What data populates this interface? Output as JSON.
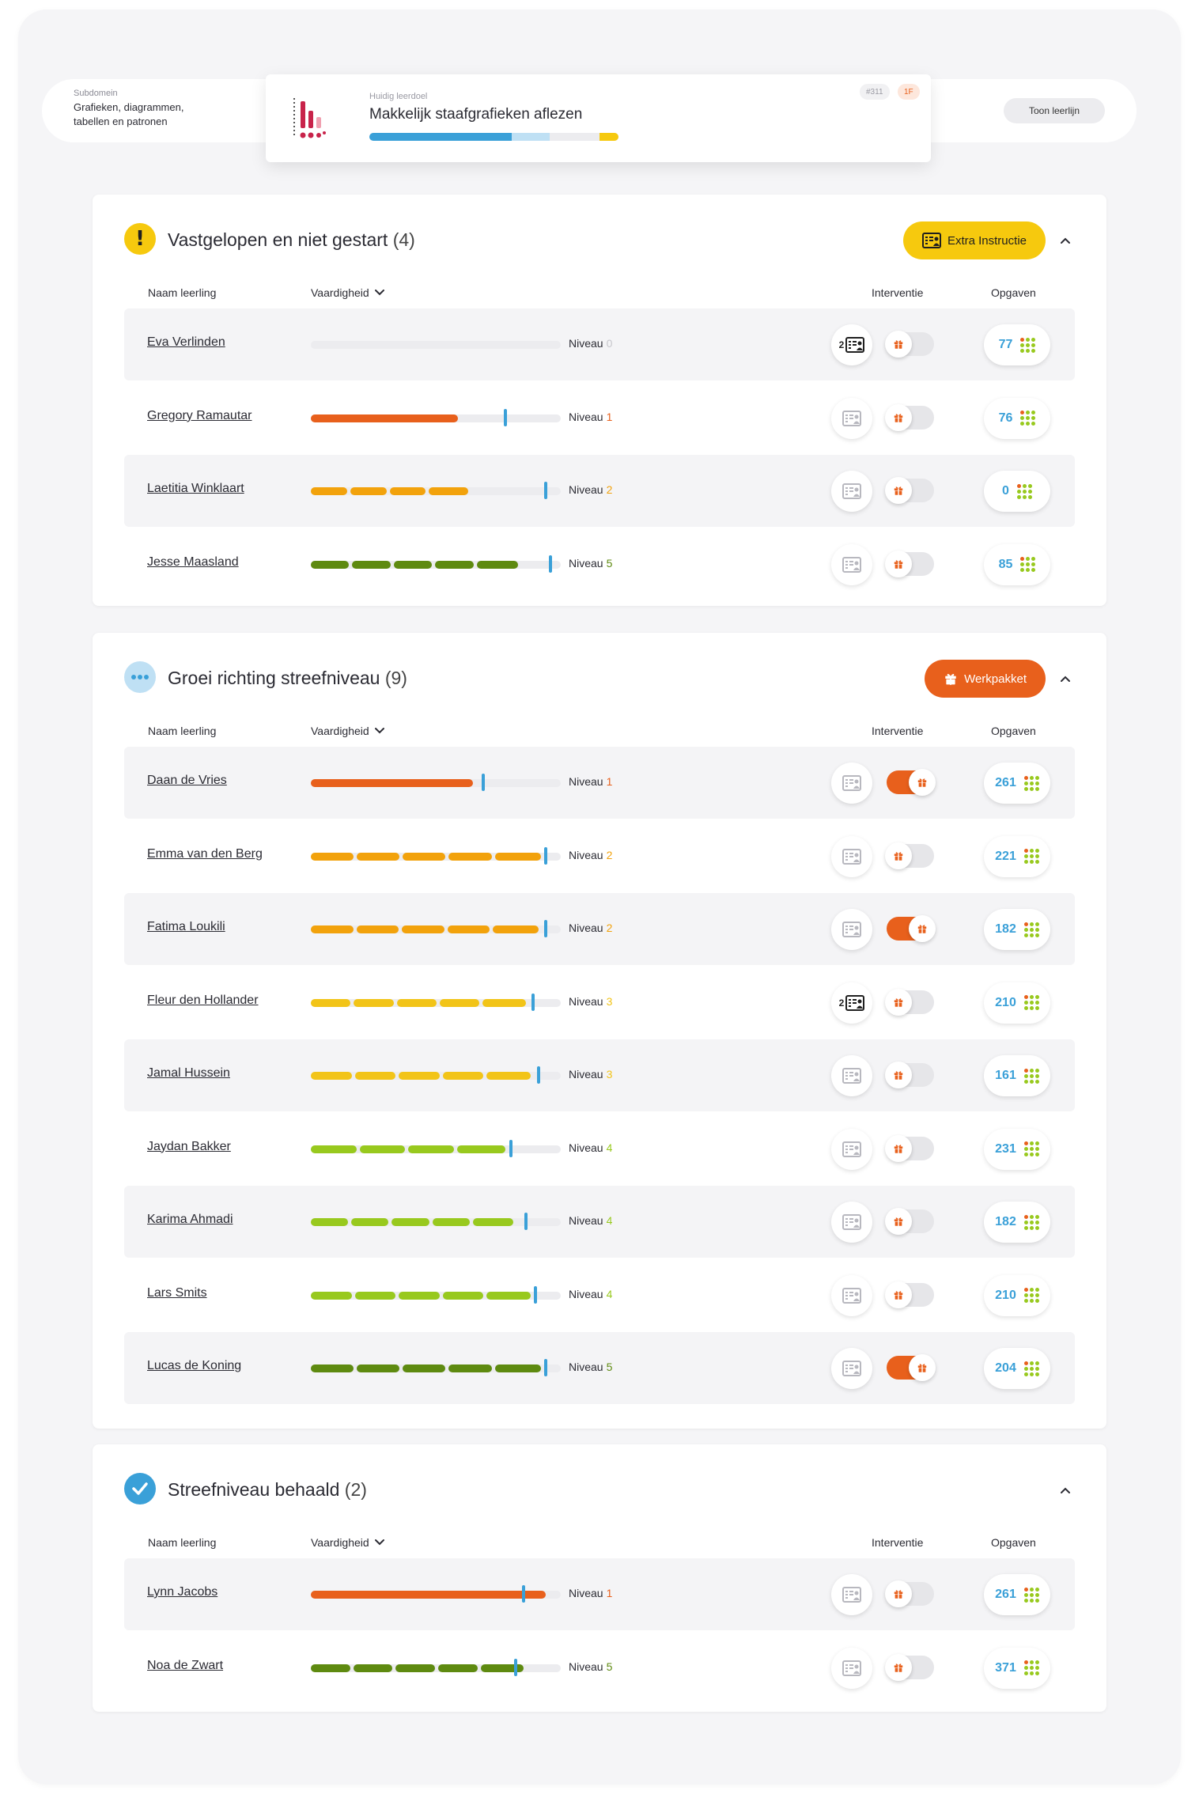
{
  "header": {
    "subdomain_label": "Subdomein",
    "subdomain_value": "Grafieken, diagrammen, tabellen en patronen",
    "goal_label": "Huidig leerdoel",
    "goal_title": "Makkelijk staafgrafieken aflezen",
    "goal_id": "#311",
    "goal_level": "1F",
    "show_button": "Toon leerlijn"
  },
  "columns": {
    "name": "Naam leerling",
    "skill": "Vaardigheid",
    "intervention": "Interventie",
    "tasks": "Opgaven"
  },
  "level_word": "Niveau",
  "level_colors": {
    "0": "#c7c7cc",
    "1": "#e8601c",
    "2": "#f2a20c",
    "3": "#f2c418",
    "4": "#98c91e",
    "5": "#5e8a10"
  },
  "sections": [
    {
      "title": "Vastgelopen en niet gestart",
      "count": "(4)",
      "status_icon": "exclamation-icon",
      "status_color": "#f6c90e",
      "action_label": "Extra Instructie",
      "action_icon": "instruction-icon",
      "action_color": "#f6c90e",
      "students": [
        {
          "name": "Eva Verlinden",
          "level": "0",
          "progress": 0.0,
          "marker": null,
          "intervention_count": "2",
          "intervention_active": true,
          "toggle": false,
          "tasks": "77"
        },
        {
          "name": "Gregory Ramautar",
          "level": "1",
          "progress": 0.59,
          "marker": 0.78,
          "intervention_count": "",
          "intervention_active": false,
          "toggle": false,
          "tasks": "76"
        },
        {
          "name": "Laetitia Winklaart",
          "level": "2",
          "progress": 0.63,
          "marker": 0.94,
          "intervention_count": "",
          "intervention_active": false,
          "toggle": false,
          "tasks": "0"
        },
        {
          "name": "Jesse Maasland",
          "level": "5",
          "progress": 0.83,
          "marker": 0.96,
          "intervention_count": "",
          "intervention_active": false,
          "toggle": false,
          "tasks": "85"
        }
      ]
    },
    {
      "title": "Groei richting streefniveau",
      "count": "(9)",
      "status_icon": "more-dots-icon",
      "status_color": "#bfe0f4",
      "action_label": "Werkpakket",
      "action_icon": "gift-icon",
      "action_color": "#e8601c",
      "students": [
        {
          "name": "Daan de Vries",
          "level": "1",
          "progress": 0.65,
          "marker": 0.69,
          "intervention_count": "",
          "intervention_active": false,
          "toggle": true,
          "tasks": "261"
        },
        {
          "name": "Emma van den Berg",
          "level": "2",
          "progress": 0.92,
          "marker": 0.94,
          "intervention_count": "",
          "intervention_active": false,
          "toggle": false,
          "tasks": "221"
        },
        {
          "name": "Fatima Loukili",
          "level": "2",
          "progress": 0.91,
          "marker": 0.94,
          "intervention_count": "",
          "intervention_active": false,
          "toggle": true,
          "tasks": "182"
        },
        {
          "name": "Fleur den Hollander",
          "level": "3",
          "progress": 0.86,
          "marker": 0.89,
          "intervention_count": "2",
          "intervention_active": true,
          "toggle": false,
          "tasks": "210"
        },
        {
          "name": "Jamal Hussein",
          "level": "3",
          "progress": 0.88,
          "marker": 0.91,
          "intervention_count": "",
          "intervention_active": false,
          "toggle": false,
          "tasks": "161"
        },
        {
          "name": "Jaydan Bakker",
          "level": "4",
          "progress": 0.78,
          "marker": 0.8,
          "intervention_count": "",
          "intervention_active": false,
          "toggle": false,
          "tasks": "231"
        },
        {
          "name": "Karima Ahmadi",
          "level": "4",
          "progress": 0.81,
          "marker": 0.86,
          "intervention_count": "",
          "intervention_active": false,
          "toggle": false,
          "tasks": "182"
        },
        {
          "name": "Lars Smits",
          "level": "4",
          "progress": 0.88,
          "marker": 0.9,
          "intervention_count": "",
          "intervention_active": false,
          "toggle": false,
          "tasks": "210"
        },
        {
          "name": "Lucas de Koning",
          "level": "5",
          "progress": 0.92,
          "marker": 0.94,
          "intervention_count": "",
          "intervention_active": false,
          "toggle": true,
          "tasks": "204"
        }
      ]
    },
    {
      "title": "Streefniveau behaald",
      "count": "(2)",
      "status_icon": "check-icon",
      "status_color": "#3aa0d8",
      "action_label": "",
      "action_icon": "",
      "action_color": "",
      "students": [
        {
          "name": "Lynn Jacobs",
          "level": "1",
          "progress": 0.94,
          "marker": 0.85,
          "intervention_count": "",
          "intervention_active": false,
          "toggle": false,
          "tasks": "261"
        },
        {
          "name": "Noa de Zwart",
          "level": "5",
          "progress": 0.85,
          "marker": 0.82,
          "intervention_count": "",
          "intervention_active": false,
          "toggle": false,
          "tasks": "371"
        }
      ]
    }
  ]
}
